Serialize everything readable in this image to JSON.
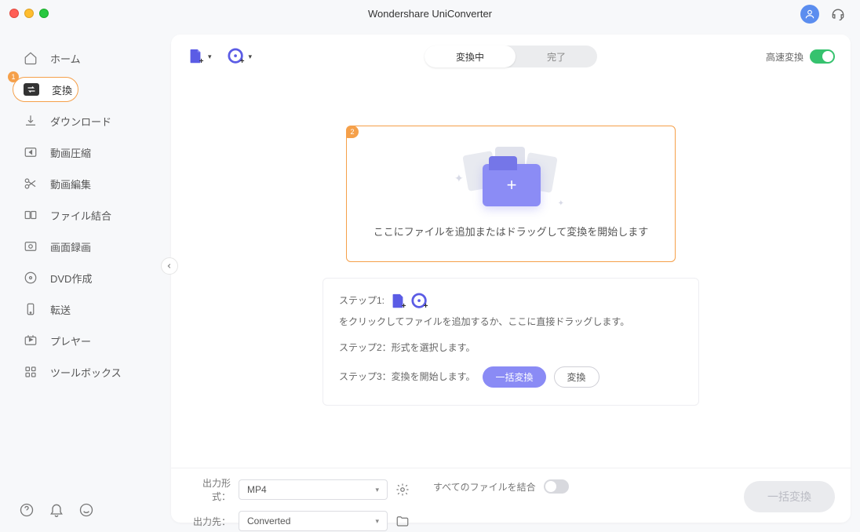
{
  "title": "Wondershare UniConverter",
  "sidebar": {
    "items": [
      {
        "label": "ホーム"
      },
      {
        "label": "変換"
      },
      {
        "label": "ダウンロード"
      },
      {
        "label": "動画圧縮"
      },
      {
        "label": "動画編集"
      },
      {
        "label": "ファイル結合"
      },
      {
        "label": "画面録画"
      },
      {
        "label": "DVD作成"
      },
      {
        "label": "転送"
      },
      {
        "label": "プレヤー"
      },
      {
        "label": "ツールボックス"
      }
    ],
    "active_badge": "1"
  },
  "tabs": {
    "converting": "変換中",
    "done": "完了"
  },
  "fast_convert": "高速変換",
  "dropzone": {
    "badge": "2",
    "text": "ここにファイルを追加またはドラッグして変換を開始します"
  },
  "steps": {
    "s1_pre": "ステップ1:",
    "s1_post": "をクリックしてファイルを追加するか、ここに直接ドラッグします。",
    "s2": "ステップ2：形式を選択します。",
    "s3": "ステップ3：変換を開始します。",
    "batch_btn": "一括変換",
    "conv_btn": "変換"
  },
  "footer": {
    "format_label": "出力形式：",
    "format_value": "MP4",
    "dest_label": "出力先：",
    "dest_value": "Converted",
    "merge_label": "すべてのファイルを結合",
    "batch_main": "一括変換"
  }
}
